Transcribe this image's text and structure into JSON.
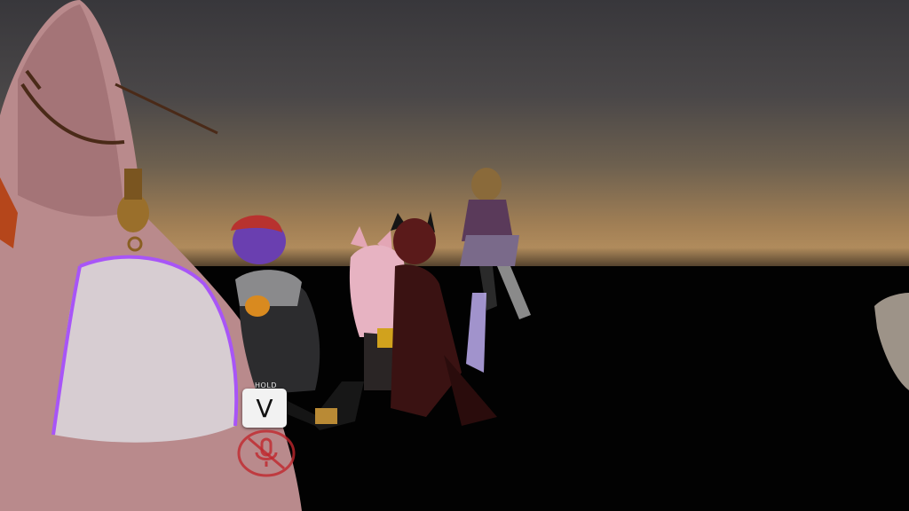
{
  "hud": {
    "push_to_talk_hint": "HOLD",
    "push_to_talk_key": "V",
    "mic_status_icon": "mic-muted-icon"
  },
  "colors": {
    "mic_muted": "#c0272d",
    "sky_horizon": "#b08b5c",
    "selection_outline": "#a855f7"
  }
}
